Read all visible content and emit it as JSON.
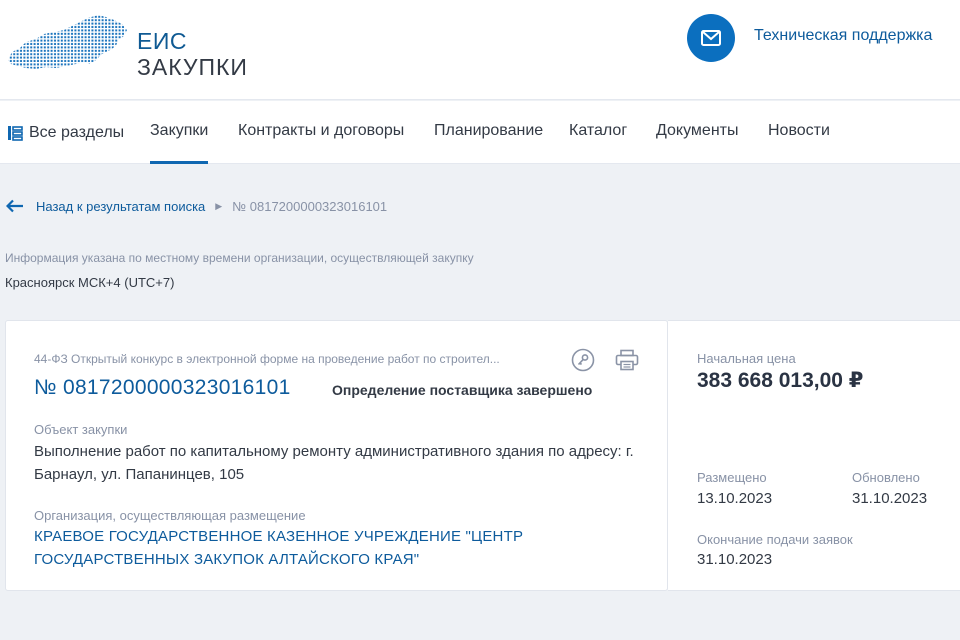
{
  "header": {
    "logo_line1": "ЕИС",
    "logo_line2": "ЗАКУПКИ",
    "support_label": "Техническая поддержка",
    "support_icon": "mail-icon",
    "accent_color": "#0b6fbf"
  },
  "nav": {
    "all_sections": "Все разделы",
    "items": [
      "Закупки",
      "Контракты и договоры",
      "Планирование",
      "Каталог",
      "Документы",
      "Новости"
    ],
    "active": "Закупки"
  },
  "breadcrumb": {
    "back": "Назад к результатам поиска",
    "current": "№ 0817200000323016101"
  },
  "timezone": {
    "note": "Информация указана по местному времени организации, осуществляющей закупку",
    "value": "Красноярск МСК+4 (UTC+7)"
  },
  "procurement": {
    "type": "44-ФЗ Открытый конкурс в электронной форме на проведение работ по строител...",
    "number": "№ 0817200000323016101",
    "status": "Определение поставщика завершено",
    "object_label": "Объект закупки",
    "object_value": "Выполнение работ по капитальному ремонту административного здания по адресу: г. Барнаул, ул. Папанинцев, 105",
    "org_label": "Организация, осуществляющая размещение",
    "org_value": "КРАЕВОЕ ГОСУДАРСТВЕННОЕ КАЗЕННОЕ УЧРЕЖДЕНИЕ \"ЦЕНТР ГОСУДАРСТВЕННЫХ ЗАКУПОК АЛТАЙСКОГО КРАЯ\""
  },
  "summary": {
    "price_label": "Начальная цена",
    "price_value": "383 668 013,00 ₽",
    "posted_label": "Размещено",
    "posted_value": "13.10.2023",
    "updated_label": "Обновлено",
    "updated_value": "31.10.2023",
    "deadline_label": "Окончание подачи заявок",
    "deadline_value": "31.10.2023"
  }
}
